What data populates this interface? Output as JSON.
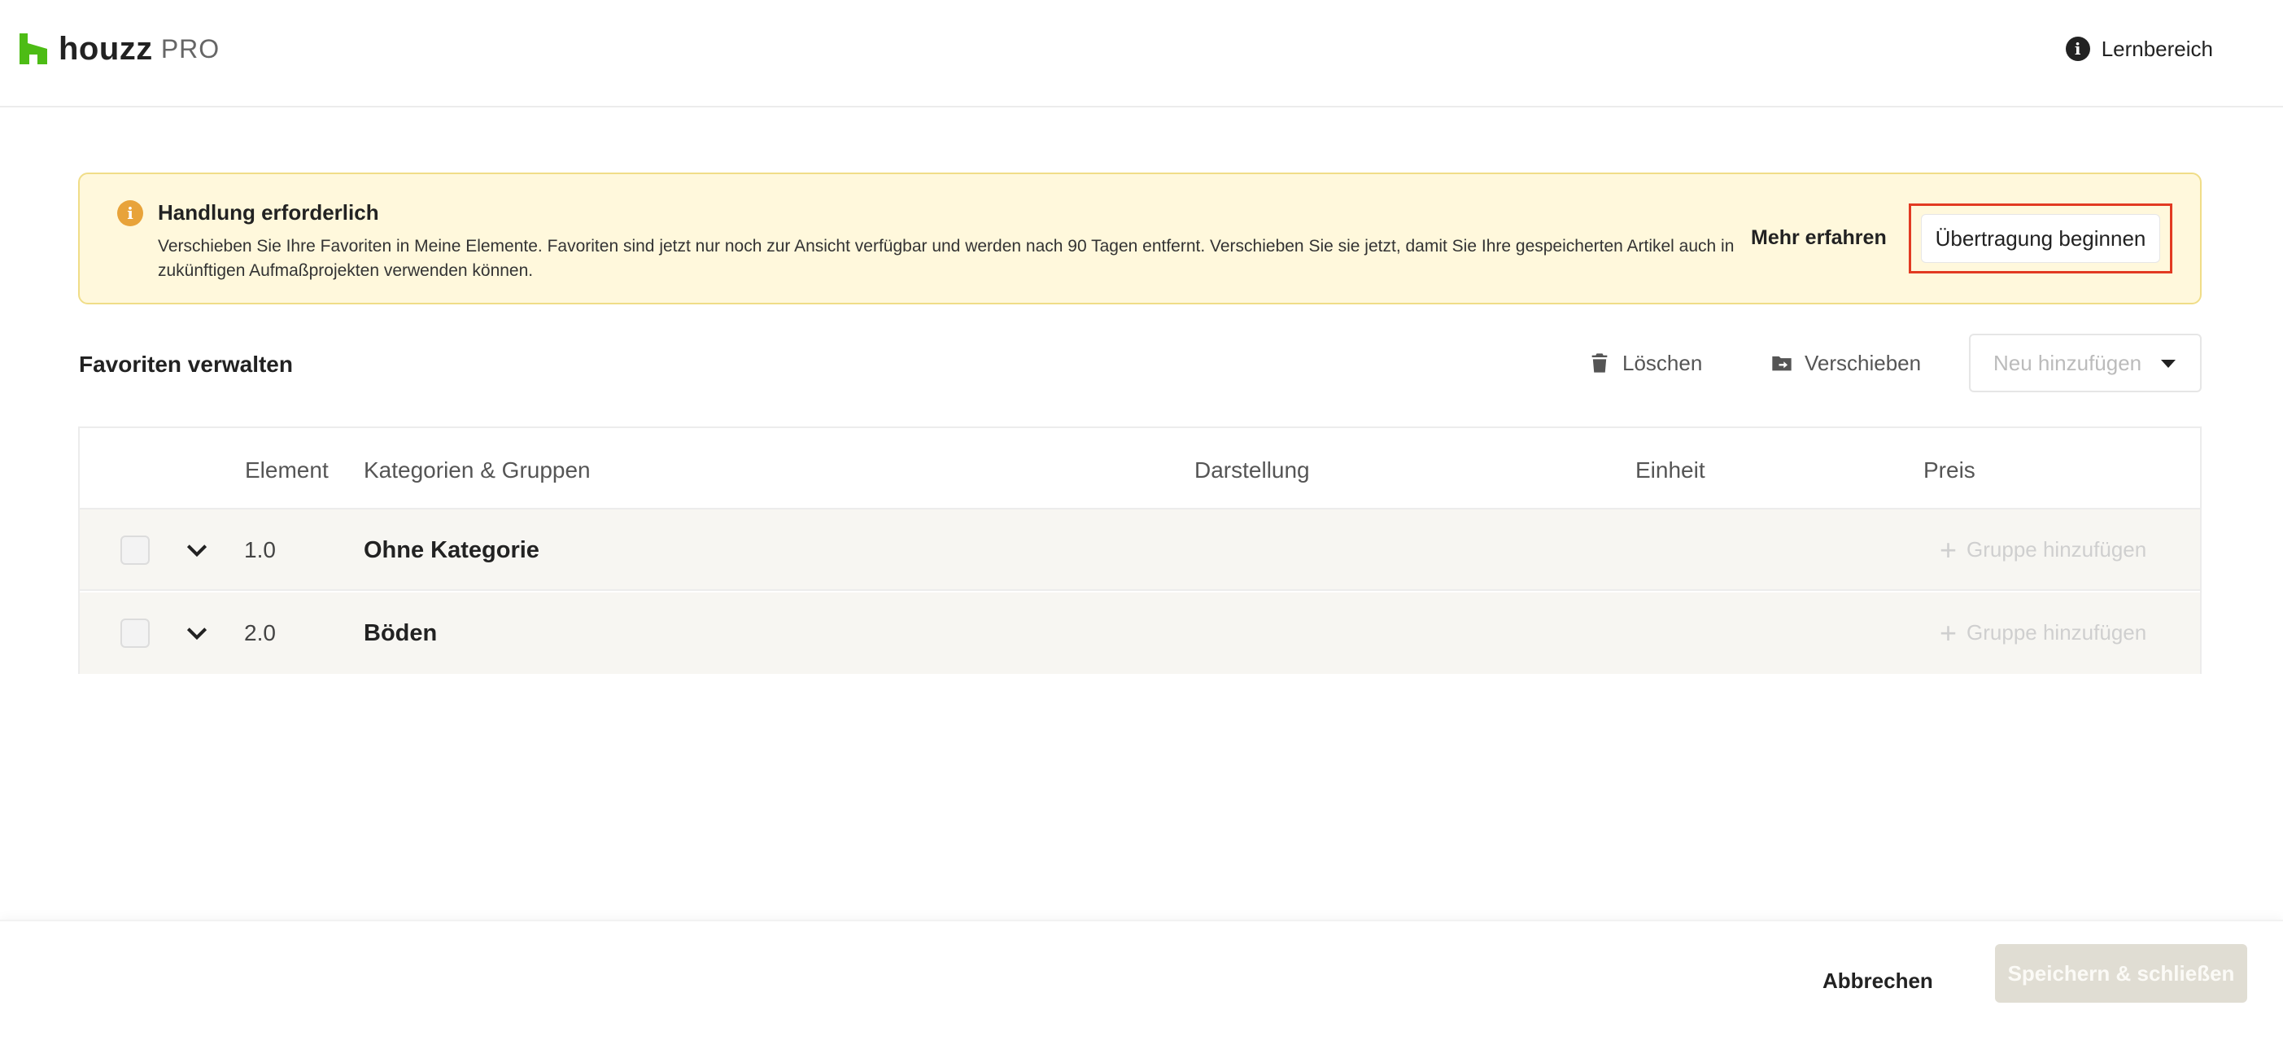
{
  "header": {
    "logo_text": "houzz",
    "logo_pro": "PRO",
    "learn_label": "Lernbereich",
    "learn_icon": "info-icon"
  },
  "banner": {
    "icon": "info-icon",
    "title": "Handlung erforderlich",
    "text": "Verschieben Sie Ihre Favoriten in Meine Elemente. Favoriten sind jetzt nur noch zur Ansicht verfügbar und werden nach 90 Tagen entfernt. Verschieben Sie sie jetzt, damit Sie Ihre gespeicherten Artikel auch in zukünftigen Aufmaßprojekten verwenden können.",
    "more_label": "Mehr erfahren",
    "start_label": "Übertragung beginnen",
    "background_color": "#fff8dc",
    "highlight_color": "#e23a22"
  },
  "toolbar": {
    "title": "Favoriten verwalten",
    "delete_label": "Löschen",
    "move_label": "Verschieben",
    "new_label": "Neu hinzufügen"
  },
  "table": {
    "columns": [
      "Element",
      "Kategorien & Gruppen",
      "Darstellung",
      "Einheit",
      "Preis"
    ],
    "rows": [
      {
        "number": "1.0",
        "category": "Ohne Kategorie",
        "action": "Gruppe hinzufügen"
      },
      {
        "number": "2.0",
        "category": "Böden",
        "action": "Gruppe hinzufügen"
      }
    ]
  },
  "footer": {
    "cancel_label": "Abbrechen",
    "save_label": "Speichern & schließen"
  },
  "colors": {
    "brand_green": "#4dbc15",
    "row_background": "#f7f6f2",
    "disabled_button": "#e0ddd3"
  }
}
